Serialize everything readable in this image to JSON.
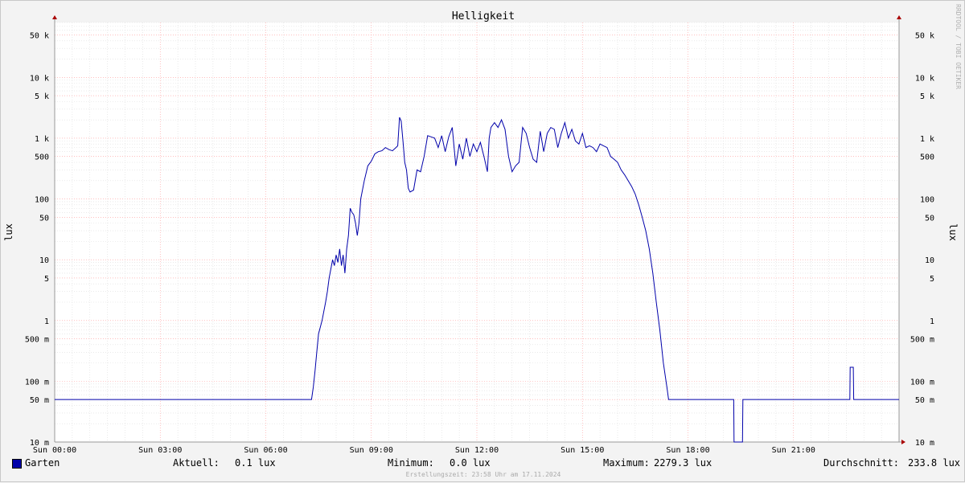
{
  "chart_data": {
    "type": "line",
    "title": "Helligkeit",
    "ylabel_left": "lux",
    "ylabel_right": "lux",
    "yscale": "log",
    "ylim": [
      0.01,
      80000
    ],
    "xlim_hours": [
      0,
      24
    ],
    "ytick_labels": [
      {
        "v": 50000,
        "label": "50 k"
      },
      {
        "v": 10000,
        "label": "10 k"
      },
      {
        "v": 5000,
        "label": "5 k"
      },
      {
        "v": 1000,
        "label": "1 k"
      },
      {
        "v": 500,
        "label": "500"
      },
      {
        "v": 100,
        "label": "100"
      },
      {
        "v": 50,
        "label": "50"
      },
      {
        "v": 10,
        "label": "10"
      },
      {
        "v": 5,
        "label": "5"
      },
      {
        "v": 1,
        "label": "1"
      },
      {
        "v": 0.5,
        "label": "500 m"
      },
      {
        "v": 0.1,
        "label": "100 m"
      },
      {
        "v": 0.05,
        "label": "50 m"
      },
      {
        "v": 0.01,
        "label": "10 m"
      }
    ],
    "xtick_labels": [
      {
        "h": 0,
        "label": "Sun 00:00"
      },
      {
        "h": 3,
        "label": "Sun 03:00"
      },
      {
        "h": 6,
        "label": "Sun 06:00"
      },
      {
        "h": 9,
        "label": "Sun 09:00"
      },
      {
        "h": 12,
        "label": "Sun 12:00"
      },
      {
        "h": 15,
        "label": "Sun 15:00"
      },
      {
        "h": 18,
        "label": "Sun 18:00"
      },
      {
        "h": 21,
        "label": "Sun 21:00"
      }
    ],
    "grid": true,
    "series": [
      {
        "name": "Garten",
        "color": "#0000aa",
        "points": [
          [
            0,
            0.05
          ],
          [
            7.3,
            0.05
          ],
          [
            7.35,
            0.08
          ],
          [
            7.4,
            0.15
          ],
          [
            7.45,
            0.3
          ],
          [
            7.5,
            0.6
          ],
          [
            7.6,
            1
          ],
          [
            7.7,
            2
          ],
          [
            7.75,
            3
          ],
          [
            7.8,
            5
          ],
          [
            7.85,
            7
          ],
          [
            7.9,
            10
          ],
          [
            7.95,
            8
          ],
          [
            8.0,
            12
          ],
          [
            8.05,
            9
          ],
          [
            8.1,
            15
          ],
          [
            8.15,
            8
          ],
          [
            8.2,
            12
          ],
          [
            8.25,
            6
          ],
          [
            8.3,
            15
          ],
          [
            8.35,
            25
          ],
          [
            8.4,
            70
          ],
          [
            8.45,
            60
          ],
          [
            8.5,
            55
          ],
          [
            8.55,
            40
          ],
          [
            8.6,
            25
          ],
          [
            8.65,
            40
          ],
          [
            8.7,
            100
          ],
          [
            8.8,
            200
          ],
          [
            8.9,
            350
          ],
          [
            9.0,
            420
          ],
          [
            9.1,
            550
          ],
          [
            9.2,
            600
          ],
          [
            9.3,
            620
          ],
          [
            9.4,
            700
          ],
          [
            9.5,
            650
          ],
          [
            9.6,
            620
          ],
          [
            9.7,
            700
          ],
          [
            9.75,
            750
          ],
          [
            9.8,
            2200
          ],
          [
            9.85,
            1900
          ],
          [
            9.9,
            900
          ],
          [
            9.95,
            400
          ],
          [
            10.0,
            300
          ],
          [
            10.05,
            150
          ],
          [
            10.1,
            130
          ],
          [
            10.2,
            140
          ],
          [
            10.3,
            300
          ],
          [
            10.4,
            280
          ],
          [
            10.5,
            500
          ],
          [
            10.6,
            1100
          ],
          [
            10.7,
            1050
          ],
          [
            10.8,
            1000
          ],
          [
            10.9,
            700
          ],
          [
            11.0,
            1100
          ],
          [
            11.1,
            600
          ],
          [
            11.2,
            1050
          ],
          [
            11.3,
            1500
          ],
          [
            11.4,
            350
          ],
          [
            11.5,
            800
          ],
          [
            11.6,
            450
          ],
          [
            11.7,
            1000
          ],
          [
            11.8,
            500
          ],
          [
            11.9,
            800
          ],
          [
            12.0,
            600
          ],
          [
            12.1,
            850
          ],
          [
            12.2,
            500
          ],
          [
            12.3,
            280
          ],
          [
            12.35,
            1000
          ],
          [
            12.4,
            1500
          ],
          [
            12.5,
            1800
          ],
          [
            12.6,
            1500
          ],
          [
            12.7,
            2000
          ],
          [
            12.8,
            1400
          ],
          [
            12.9,
            500
          ],
          [
            13.0,
            280
          ],
          [
            13.1,
            350
          ],
          [
            13.2,
            400
          ],
          [
            13.3,
            1500
          ],
          [
            13.4,
            1200
          ],
          [
            13.5,
            700
          ],
          [
            13.6,
            450
          ],
          [
            13.7,
            400
          ],
          [
            13.8,
            1300
          ],
          [
            13.9,
            600
          ],
          [
            14.0,
            1200
          ],
          [
            14.1,
            1500
          ],
          [
            14.2,
            1400
          ],
          [
            14.3,
            700
          ],
          [
            14.4,
            1200
          ],
          [
            14.5,
            1800
          ],
          [
            14.6,
            1000
          ],
          [
            14.7,
            1400
          ],
          [
            14.8,
            900
          ],
          [
            14.9,
            800
          ],
          [
            15.0,
            1200
          ],
          [
            15.1,
            700
          ],
          [
            15.2,
            750
          ],
          [
            15.3,
            700
          ],
          [
            15.4,
            600
          ],
          [
            15.5,
            800
          ],
          [
            15.6,
            750
          ],
          [
            15.7,
            700
          ],
          [
            15.8,
            500
          ],
          [
            15.9,
            450
          ],
          [
            16.0,
            400
          ],
          [
            16.1,
            300
          ],
          [
            16.2,
            250
          ],
          [
            16.3,
            200
          ],
          [
            16.4,
            160
          ],
          [
            16.5,
            120
          ],
          [
            16.6,
            80
          ],
          [
            16.7,
            50
          ],
          [
            16.8,
            30
          ],
          [
            16.9,
            15
          ],
          [
            17.0,
            6
          ],
          [
            17.1,
            2
          ],
          [
            17.2,
            0.7
          ],
          [
            17.3,
            0.2
          ],
          [
            17.4,
            0.08
          ],
          [
            17.45,
            0.05
          ],
          [
            19.3,
            0.05
          ],
          [
            19.31,
            0.01
          ],
          [
            19.55,
            0.01
          ],
          [
            19.56,
            0.05
          ],
          [
            22.6,
            0.05
          ],
          [
            22.61,
            0.17
          ],
          [
            22.7,
            0.17
          ],
          [
            22.71,
            0.05
          ],
          [
            24.0,
            0.05
          ]
        ]
      }
    ]
  },
  "legend": {
    "series_name": "Garten",
    "current_label": "Aktuell:",
    "current_value": "0.1 lux",
    "min_label": "Minimum:",
    "min_value": "0.0 lux",
    "max_label": "Maximum:",
    "max_value": "2279.3 lux",
    "avg_label": "Durchschnitt:",
    "avg_value": "233.8 lux"
  },
  "footer": "Erstellungszeit: 23:58 Uhr am 17.11.2024",
  "watermark": "RRDTOOL / TOBI OETIKER",
  "colors": {
    "background": "#f3f3f3",
    "plot_bg": "#ffffff",
    "series": "#0000aa",
    "major_grid": "#ff9999",
    "minor_grid": "#dddddd",
    "axis_arrow": "#aa0000"
  }
}
